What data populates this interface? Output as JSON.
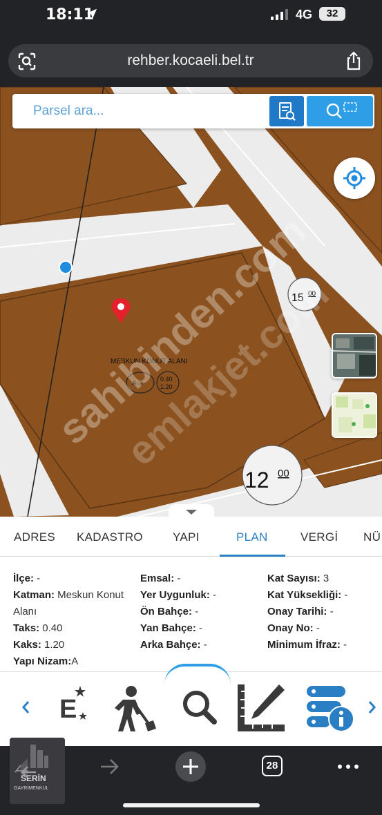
{
  "status": {
    "time": "18:11",
    "network": "4G",
    "battery": "32"
  },
  "browser": {
    "url": "rehber.kocaeli.bel.tr",
    "tab_count": "28"
  },
  "map": {
    "search_placeholder": "Parsel ara...",
    "zone_label": "MESKUN KONUT ALANI",
    "zone_code": "A-3",
    "ratio_top": "0.40",
    "ratio_bottom": "1.20",
    "road_width_1": "15",
    "road_width_1_sup": "00",
    "road_width_2": "12",
    "road_width_2_sup": "00",
    "watermark_1": "sahibinden.com",
    "watermark_2": "emlakjet.com"
  },
  "tabs": [
    {
      "label": "ADRES"
    },
    {
      "label": "KADASTRO"
    },
    {
      "label": "YAPI"
    },
    {
      "label": "PLAN"
    },
    {
      "label": "VERGİ"
    },
    {
      "label": "NÜ"
    }
  ],
  "active_tab": "PLAN",
  "plan": {
    "col1": [
      {
        "k": "İlçe:",
        "v": " -"
      },
      {
        "k": "Katman:",
        "v": " Meskun Konut"
      },
      {
        "k": "",
        "v": "Alanı"
      },
      {
        "k": "Taks:",
        "v": " 0.40"
      },
      {
        "k": "Kaks:",
        "v": " 1.20"
      },
      {
        "k": "Yapı Nizam:",
        "v": "A"
      }
    ],
    "col2": [
      {
        "k": "Emsal:",
        "v": " -"
      },
      {
        "k": "Yer Uygunluk:",
        "v": " -"
      },
      {
        "k": "Ön Bahçe:",
        "v": " -"
      },
      {
        "k": "Yan Bahçe:",
        "v": " -"
      },
      {
        "k": "Arka Bahçe:",
        "v": " -"
      }
    ],
    "col3": [
      {
        "k": "Kat Sayısı:",
        "v": " 3"
      },
      {
        "k": "Kat Yüksekliği:",
        "v": " -"
      },
      {
        "k": "Onay Tarihi:",
        "v": " -"
      },
      {
        "k": "Onay No:",
        "v": " -"
      },
      {
        "k": "Minimum İfraz:",
        "v": " -"
      }
    ]
  },
  "logo": {
    "name": "SERİN",
    "sub": "GAYRİMENKUL"
  },
  "colors": {
    "parcel": "#8b5220",
    "road": "#eeeeee",
    "accent": "#2a7fc4",
    "button": "#2e9fe6"
  }
}
